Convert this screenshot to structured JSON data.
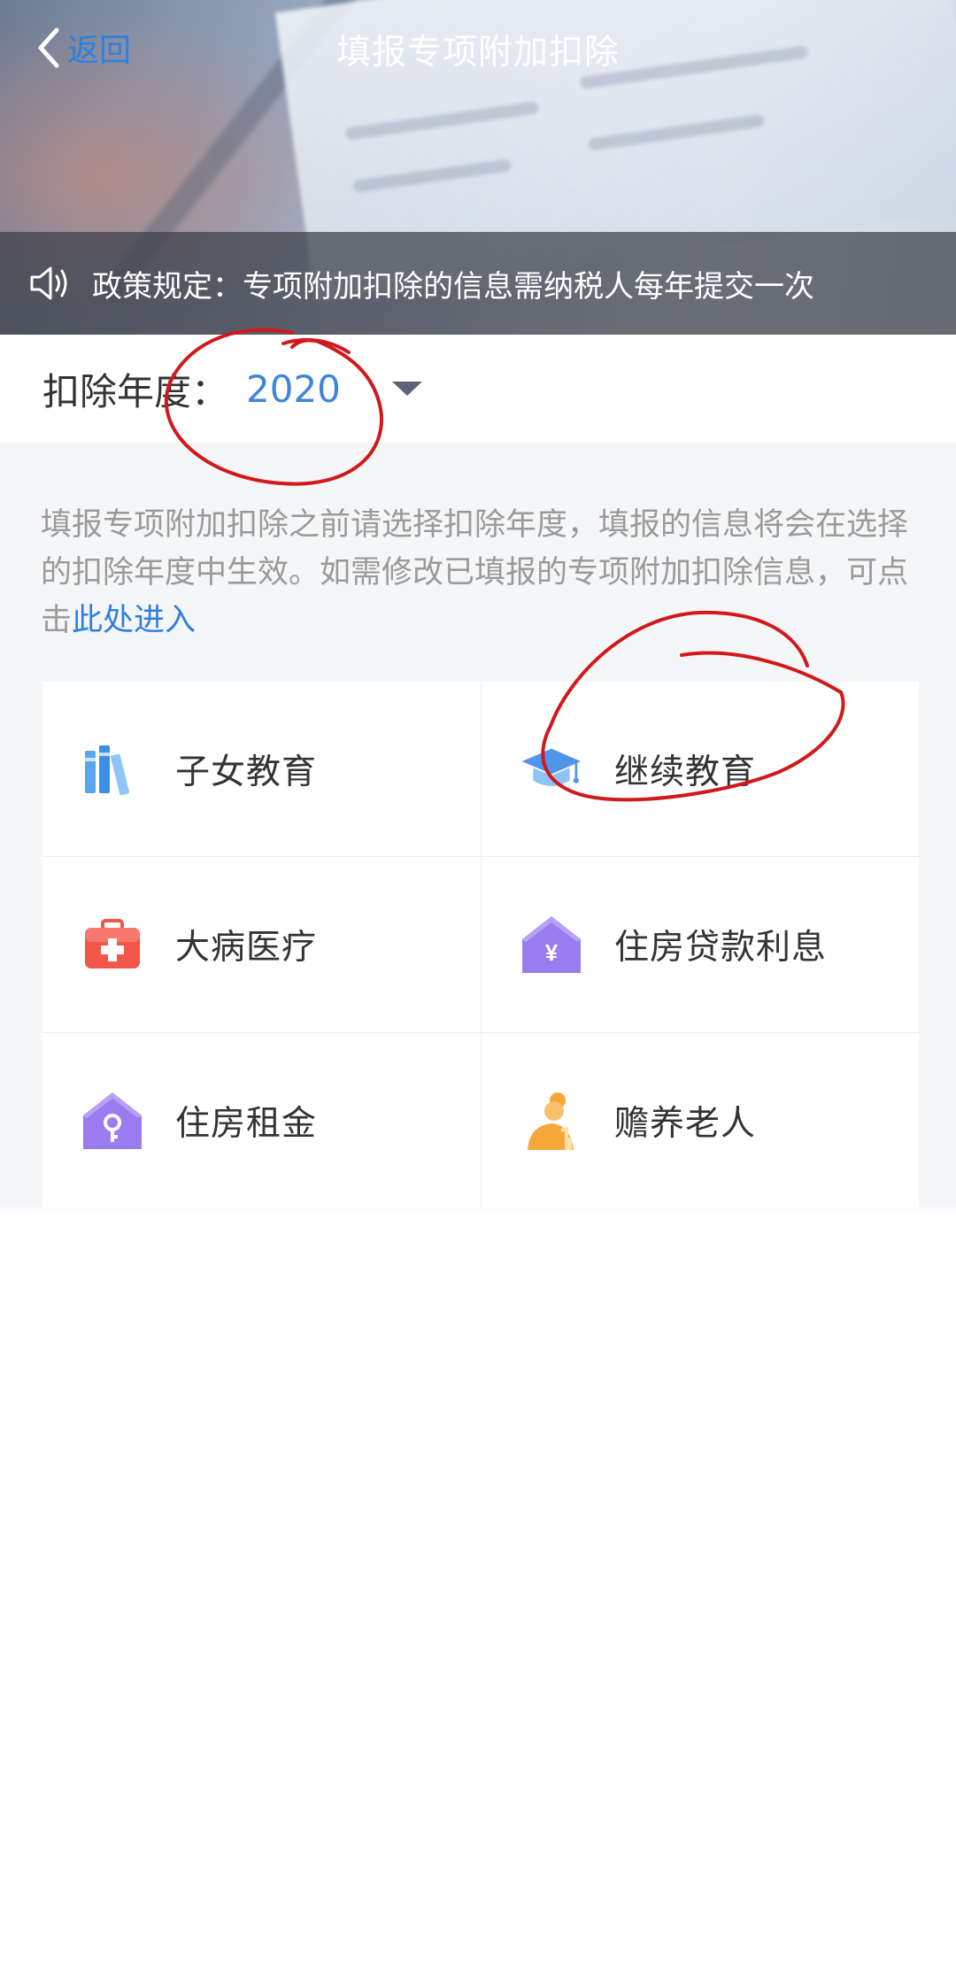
{
  "nav": {
    "back_label": "返回",
    "title": "填报专项附加扣除"
  },
  "notice": {
    "icon": "speaker-icon",
    "text": "政策规定：专项附加扣除的信息需纳税人每年提交一次"
  },
  "year_selector": {
    "label": "扣除年度：",
    "value": "2020",
    "icon": "caret-down-icon"
  },
  "description": {
    "text": "填报专项附加扣除之前请选择扣除年度，填报的信息将会在选择的扣除年度中生效。如需修改已填报的专项附加扣除信息，可点击",
    "link_text": "此处进入"
  },
  "categories": [
    {
      "label": "子女教育",
      "icon": "books-icon",
      "color": "#5aa7f0"
    },
    {
      "label": "继续教育",
      "icon": "graduation-cap-icon",
      "color": "#4f96ea"
    },
    {
      "label": "大病医疗",
      "icon": "first-aid-kit-icon",
      "color": "#f2564a"
    },
    {
      "label": "住房贷款利息",
      "icon": "house-yen-icon",
      "color": "#9a7cf0"
    },
    {
      "label": "住房租金",
      "icon": "house-key-icon",
      "color": "#9a7cf0"
    },
    {
      "label": "赡养老人",
      "icon": "elderly-person-icon",
      "color": "#f7a63a"
    }
  ],
  "annotation_color": "#d0191b"
}
